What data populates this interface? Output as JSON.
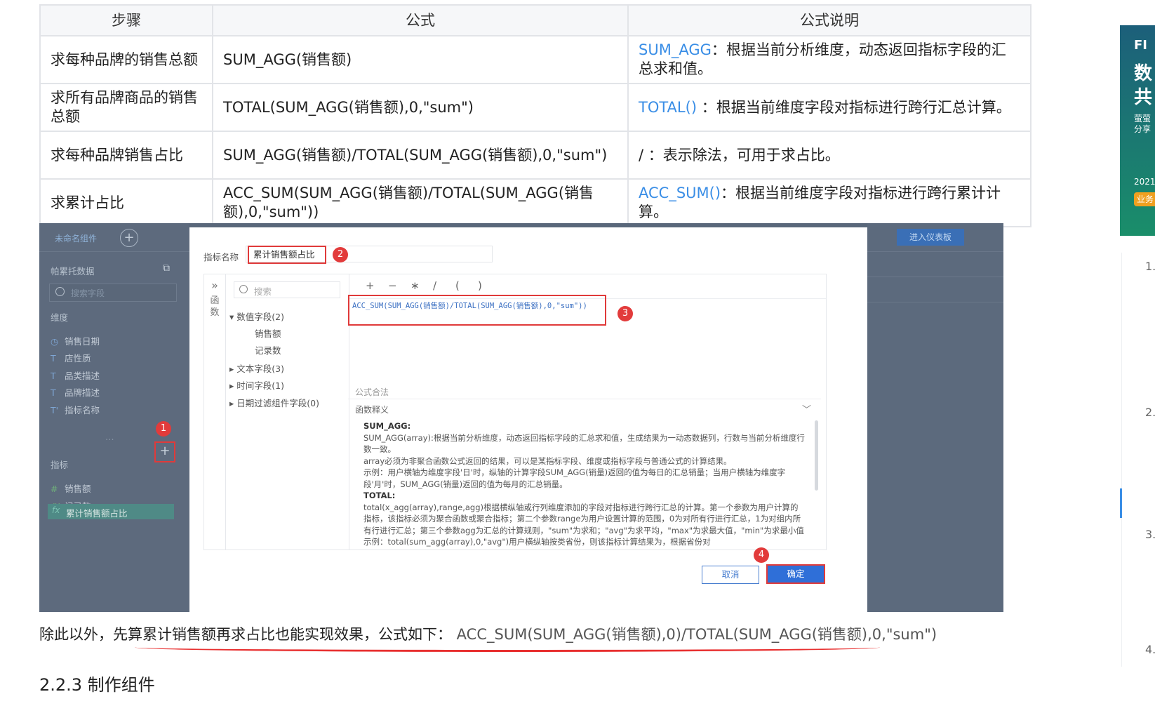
{
  "table": {
    "headers": [
      "步骤",
      "公式",
      "公式说明"
    ],
    "rows": [
      {
        "step": "求每种品牌的销售总额",
        "formula": "SUM_AGG(销售额)",
        "fn": "SUM_AGG",
        "desc": "：根据当前分析维度，动态返回指标字段的汇总求和值。"
      },
      {
        "step": "求所有品牌商品的销售总额",
        "formula": "TOTAL(SUM_AGG(销售额),0,\"sum\")",
        "fn": "TOTAL()",
        "desc": " ：根据当前维度字段对指标进行跨行汇总计算。"
      },
      {
        "step": "求每种品牌销售占比",
        "formula": "SUM_AGG(销售额)/TOTAL(SUM_AGG(销售额),0,\"sum\")",
        "fn": "",
        "desc": "/ ：表示除法，可用于求占比。"
      },
      {
        "step": "求累计占比",
        "formula": "ACC_SUM(SUM_AGG(销售额)/TOTAL(SUM_AGG(销售额),0,\"sum\"))",
        "fn": "ACC_SUM()",
        "desc": "：根据当前维度字段对指标进行跨行累计计算。"
      }
    ]
  },
  "app": {
    "tab_name": "未命名组件",
    "dataset": "帕累托数据",
    "search_placeholder": "搜索字段",
    "dimension_label": "维度",
    "dimensions": [
      {
        "icon": "◷",
        "name": "销售日期"
      },
      {
        "icon": "T",
        "name": "店性质"
      },
      {
        "icon": "T",
        "name": "品类描述"
      },
      {
        "icon": "T",
        "name": "品牌描述"
      },
      {
        "icon": "T'",
        "name": "指标名称"
      }
    ],
    "measure_label": "指标",
    "measures": [
      {
        "icon": "#",
        "name": "销售额"
      },
      {
        "icon": "#'",
        "name": "记录数"
      }
    ],
    "selected_measure": {
      "icon": "fx",
      "name": "累计销售额占比"
    },
    "dashboard_button": "进入仪表板"
  },
  "modal": {
    "name_label": "指标名称",
    "name_value": "累计销售额占比",
    "fn_tab": "函数",
    "fn_expand": "»",
    "search_placeholder": "搜索",
    "tree": [
      {
        "label": "▾ 数值字段(2)"
      },
      {
        "label": "销售额"
      },
      {
        "label": "记录数"
      },
      {
        "label": "▸ 文本字段(3)"
      },
      {
        "label": "▸ 时间字段(1)"
      },
      {
        "label": "▸ 日期过滤组件字段(0)"
      }
    ],
    "ops": [
      "+",
      "−",
      "∗",
      "/",
      "(",
      ")"
    ],
    "formula": "ACC_SUM(SUM_AGG(销售额)/TOTAL(SUM_AGG(销售额),0,\"sum\"))",
    "legal_text": "公式合法",
    "explain_title": "函数释义",
    "explain_lines": [
      {
        "bold": true,
        "text": "SUM_AGG:"
      },
      {
        "bold": false,
        "text": "SUM_AGG(array):根据当前分析维度，动态返回指标字段的汇总求和值，生成结果为一动态数据列，行数与当前分析维度行数一致。"
      },
      {
        "bold": false,
        "text": "array必须为非聚合函数公式返回的结果，可以是某指标字段、维度或指标字段与普通公式的计算结果。"
      },
      {
        "bold": false,
        "text": "示例：用户横轴为维度字段'日'时，纵轴的计算字段SUM_AGG(销量)返回的值为每日的汇总销量；当用户横轴为维度字段'月'时，SUM_AGG(销量)返回的值为每月的汇总销量。"
      },
      {
        "bold": true,
        "text": "TOTAL:"
      },
      {
        "bold": false,
        "text": "total(x_agg(array),range,agg)根据横纵轴或行列维度添加的字段对指标进行跨行汇总的计算。第一个参数为用户计算的指标，该指标必须为聚合函数或聚合指标；第二个参数range为用户设置计算的范围，0为对所有行进行汇总，1为对组内所有行进行汇总；第三个参数agg为汇总的计算规则，\"sum\"为求和；\"avg\"为求平均，\"max\"为求最大值，\"min\"为求最小值示例：total(sum_agg(array),0,\"avg\")用户横纵轴按类省份，则该指标计算结果为，根据省份对"
      }
    ],
    "cancel": "取消",
    "ok": "确定"
  },
  "badges": [
    "1",
    "2",
    "3",
    "4"
  ],
  "note": {
    "text": "除此以外，先算累计销售额再求占比也能实现效果，公式如下：",
    "code": " ACC_SUM(SUM_AGG(销售额),0)/TOTAL(SUM_AGG(销售额),0,\"sum\")"
  },
  "subhead": "2.2.3 制作组件",
  "ad": {
    "logo": "FI",
    "headline_1": "数",
    "headline_2": "共",
    "line_1": "萤萤",
    "line_2": "分享",
    "year": "2021",
    "tag": "业务"
  },
  "toc_numbers": [
    "1.",
    "2.",
    "3.",
    "4."
  ]
}
